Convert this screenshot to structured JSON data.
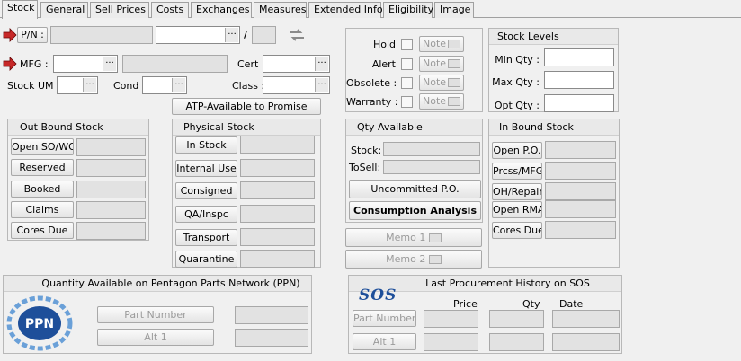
{
  "tabs": [
    {
      "label": "Stock"
    },
    {
      "label": "General"
    },
    {
      "label": "Sell Prices"
    },
    {
      "label": "Costs"
    },
    {
      "label": "Exchanges"
    },
    {
      "label": "Measures"
    },
    {
      "label": "Extended Info"
    },
    {
      "label": "Eligibility"
    },
    {
      "label": "Image"
    }
  ],
  "header": {
    "pn_label": "P/N :",
    "slash": "/",
    "mfg_label": "MFG :",
    "cert_label": "Cert :",
    "stock_um_label": "Stock UM",
    "cond_label": "Cond :",
    "class_label": "Class :",
    "lookup": "..."
  },
  "flags": {
    "hold": "Hold",
    "alert": "Alert",
    "obsolete": "Obsolete :",
    "warranty": "Warranty :",
    "note": "Note"
  },
  "stock_levels": {
    "title": "Stock Levels",
    "min": "Min Qty :",
    "max": "Max Qty :",
    "opt": "Opt Qty :"
  },
  "atp_button": "ATP-Available to Promise",
  "outbound": {
    "title": "Out Bound Stock",
    "items": [
      "Open SO/WO",
      "Reserved",
      "Booked",
      "Claims",
      "Cores Due"
    ]
  },
  "physical": {
    "title": "Physical Stock",
    "items": [
      "In Stock",
      "Internal Use",
      "Consigned",
      "QA/Inspc",
      "Transport",
      "Quarantine"
    ]
  },
  "qty_available": {
    "title": "Qty Available",
    "stock": "Stock:",
    "tosell": "ToSell:",
    "uncommitted": "Uncommitted P.O.",
    "consumption": "Consumption Analysis",
    "memo1": "Memo 1",
    "memo2": "Memo 2"
  },
  "inbound": {
    "title": "In Bound Stock",
    "items": [
      "Open P.O.",
      "Prcss/MFG",
      "OH/Repair",
      "Open RMA",
      "Cores Due"
    ]
  },
  "ppn": {
    "title": "Quantity Available on Pentagon Parts Network (PPN)",
    "logo": "PPN",
    "part_number": "Part Number",
    "alt1": "Alt 1"
  },
  "sos": {
    "title": "Last Procurement History on SOS",
    "logo": "SOS",
    "price": "Price",
    "qty": "Qty",
    "date": "Date",
    "part_number": "Part Number",
    "alt1": "Alt 1"
  }
}
